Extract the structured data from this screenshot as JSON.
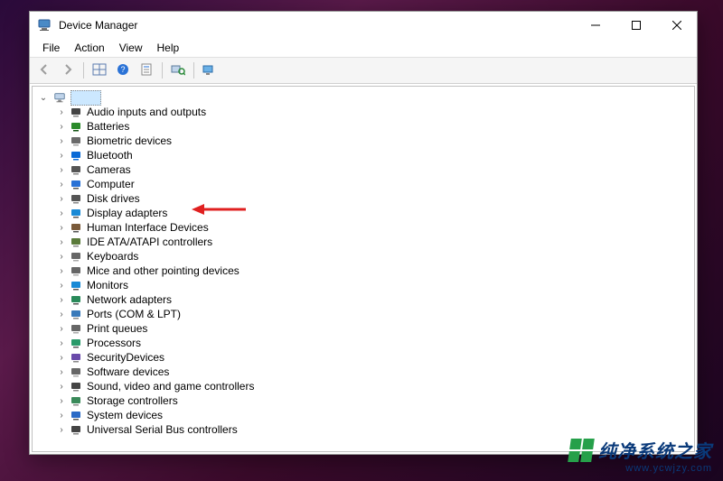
{
  "window": {
    "title": "Device Manager"
  },
  "menu": {
    "items": [
      "File",
      "Action",
      "View",
      "Help"
    ]
  },
  "toolbar": {
    "buttons": [
      {
        "name": "back-icon",
        "label": "Back",
        "disabled": true
      },
      {
        "name": "forward-icon",
        "label": "Forward",
        "disabled": true
      },
      {
        "name": "sep"
      },
      {
        "name": "show-hidden-icon",
        "label": "Show hidden"
      },
      {
        "name": "help-icon",
        "label": "Help"
      },
      {
        "name": "properties-icon",
        "label": "Properties"
      },
      {
        "name": "sep"
      },
      {
        "name": "scan-hardware-icon",
        "label": "Scan"
      },
      {
        "name": "sep"
      },
      {
        "name": "add-legacy-icon",
        "label": "Add legacy"
      }
    ]
  },
  "tree": {
    "root": {
      "label": " ",
      "expanded": true
    },
    "items": [
      {
        "label": "Audio inputs and outputs",
        "icon": "audio-icon",
        "colors": [
          "#444",
          "#888"
        ]
      },
      {
        "label": "Batteries",
        "icon": "battery-icon",
        "colors": [
          "#2a8a2a",
          "#155515"
        ]
      },
      {
        "label": "Biometric devices",
        "icon": "biometric-icon",
        "colors": [
          "#6a6a6a",
          "#a0a0a0"
        ]
      },
      {
        "label": "Bluetooth",
        "icon": "bluetooth-icon",
        "colors": [
          "#0a6ad6",
          "#0a6ad6"
        ]
      },
      {
        "label": "Cameras",
        "icon": "camera-icon",
        "colors": [
          "#555",
          "#888"
        ]
      },
      {
        "label": "Computer",
        "icon": "computer-icon",
        "colors": [
          "#2a72d6",
          "#555"
        ]
      },
      {
        "label": "Disk drives",
        "icon": "disk-icon",
        "colors": [
          "#555",
          "#888"
        ]
      },
      {
        "label": "Display adapters",
        "icon": "display-icon",
        "colors": [
          "#1a8ad6",
          "#555"
        ],
        "highlight": true
      },
      {
        "label": "Human Interface Devices",
        "icon": "hid-icon",
        "colors": [
          "#7a5a3a",
          "#555"
        ]
      },
      {
        "label": "IDE ATA/ATAPI controllers",
        "icon": "ide-icon",
        "colors": [
          "#5a7a3a",
          "#888"
        ]
      },
      {
        "label": "Keyboards",
        "icon": "keyboard-icon",
        "colors": [
          "#666",
          "#aaa"
        ]
      },
      {
        "label": "Mice and other pointing devices",
        "icon": "mouse-icon",
        "colors": [
          "#666",
          "#aaa"
        ]
      },
      {
        "label": "Monitors",
        "icon": "monitor-icon",
        "colors": [
          "#1a8ad6",
          "#555"
        ]
      },
      {
        "label": "Network adapters",
        "icon": "network-icon",
        "colors": [
          "#2a8a5a",
          "#555"
        ]
      },
      {
        "label": "Ports (COM & LPT)",
        "icon": "ports-icon",
        "colors": [
          "#3a7aba",
          "#888"
        ]
      },
      {
        "label": "Print queues",
        "icon": "print-icon",
        "colors": [
          "#666",
          "#aaa"
        ]
      },
      {
        "label": "Processors",
        "icon": "processor-icon",
        "colors": [
          "#2a9a6a",
          "#555"
        ]
      },
      {
        "label": "SecurityDevices",
        "icon": "security-icon",
        "colors": [
          "#6a4aaa",
          "#888"
        ]
      },
      {
        "label": "Software devices",
        "icon": "software-icon",
        "colors": [
          "#666",
          "#aaa"
        ]
      },
      {
        "label": "Sound, video and game controllers",
        "icon": "sound-icon",
        "colors": [
          "#444",
          "#888"
        ]
      },
      {
        "label": "Storage controllers",
        "icon": "storage-icon",
        "colors": [
          "#3a8a5a",
          "#888"
        ]
      },
      {
        "label": "System devices",
        "icon": "system-icon",
        "colors": [
          "#2a6ac6",
          "#555"
        ]
      },
      {
        "label": "Universal Serial Bus controllers",
        "icon": "usb-icon",
        "colors": [
          "#444",
          "#888"
        ]
      }
    ]
  },
  "watermark": {
    "text": "纯净系统之家",
    "url": "www.ycwjzy.com"
  }
}
